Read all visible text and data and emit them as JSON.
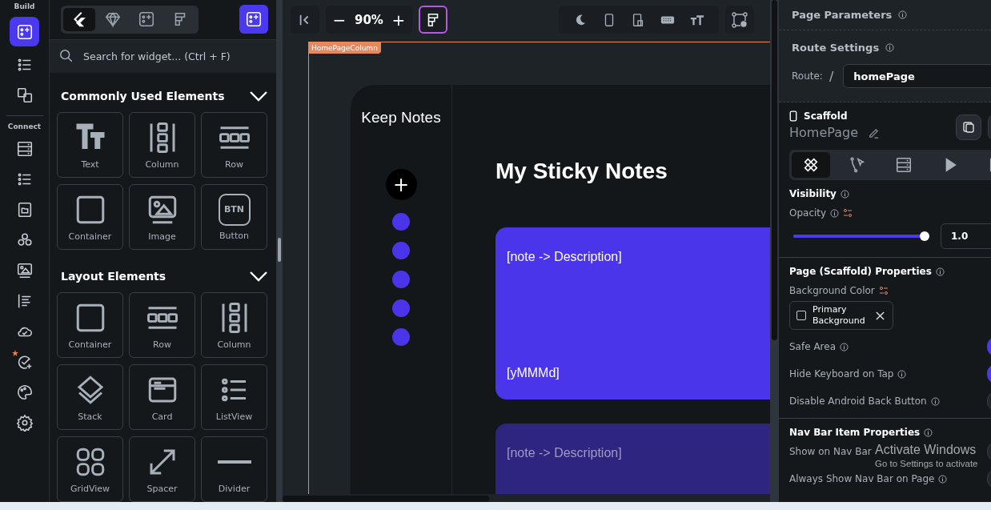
{
  "rail": {
    "sections": [
      {
        "label": "Build",
        "items": [
          {
            "selected": true
          },
          {
            "selected": false
          },
          {
            "selected": false
          }
        ]
      },
      {
        "label": "Connect",
        "items": [
          {
            "selected": false
          },
          {
            "selected": false
          },
          {
            "selected": false
          },
          {
            "selected": false
          },
          {
            "selected": false
          },
          {
            "selected": false
          },
          {
            "selected": false
          },
          {
            "selected": false
          },
          {
            "selected": false
          },
          {
            "selected": false
          }
        ]
      }
    ]
  },
  "widget_panel": {
    "tabs": [
      {
        "selected": true
      },
      {
        "selected": false
      },
      {
        "selected": false
      },
      {
        "selected": false
      }
    ],
    "search": {
      "placeholder": "Search for widget... (Ctrl + F)"
    },
    "sections": [
      {
        "title": "Commonly Used Elements",
        "expanded": true,
        "items": [
          {
            "label": "Text"
          },
          {
            "label": "Column"
          },
          {
            "label": "Row"
          },
          {
            "label": "Container"
          },
          {
            "label": "Image"
          },
          {
            "label": "Button",
            "icon_text": "BTN"
          }
        ]
      },
      {
        "title": "Layout Elements",
        "expanded": true,
        "items": [
          {
            "label": "Container"
          },
          {
            "label": "Row"
          },
          {
            "label": "Column"
          },
          {
            "label": "Stack"
          },
          {
            "label": "Card"
          },
          {
            "label": "ListView"
          },
          {
            "label": "GridView"
          },
          {
            "label": "Spacer"
          },
          {
            "label": "Divider"
          }
        ]
      }
    ]
  },
  "canvas": {
    "zoom_out": "−",
    "zoom": "90%",
    "zoom_in": "+",
    "frame_label": "HomePageColumn",
    "app": {
      "sidebar_title": "Keep Notes",
      "add_button": "+",
      "heading": "My Sticky Notes",
      "notes": [
        {
          "description": "[note -> Description]",
          "date": "[yMMMd]",
          "color": "#4b35ea"
        },
        {
          "description": "[note -> Description]",
          "color": "#2e2581"
        }
      ]
    }
  },
  "properties": {
    "page_parameters": "Page Parameters",
    "route_settings": "Route Settings",
    "route_label": "Route:",
    "route_slash": "/",
    "route": "homePage",
    "widget_type": "Scaffold",
    "widget_name": "HomePage",
    "tabs": [
      {
        "selected": true
      },
      {
        "selected": false
      },
      {
        "selected": false
      },
      {
        "selected": false
      },
      {
        "selected": false
      }
    ],
    "visibility_title": "Visibility",
    "opacity_label": "Opacity",
    "opacity": {
      "level": 1.0,
      "reading": "1.0"
    },
    "page_properties_title": "Page (Scaffold) Properties",
    "background_color_label": "Background Color",
    "background_color": "Primary Background",
    "page_toggles": [
      {
        "label": "Safe Area",
        "on": true
      },
      {
        "label": "Hide Keyboard on Tap",
        "on": true
      },
      {
        "label": "Disable Android Back Button",
        "on": false
      }
    ],
    "nav_title": "Nav Bar Item Properties",
    "nav_toggles": [
      {
        "label": "Show on Nav Bar",
        "on": false,
        "info": false
      },
      {
        "label": "Always Show Nav Bar on Page",
        "on": false,
        "info": true
      }
    ]
  },
  "os_overlay": {
    "title": "Activate Windows",
    "subtitle": "Go to Settings to activate"
  }
}
